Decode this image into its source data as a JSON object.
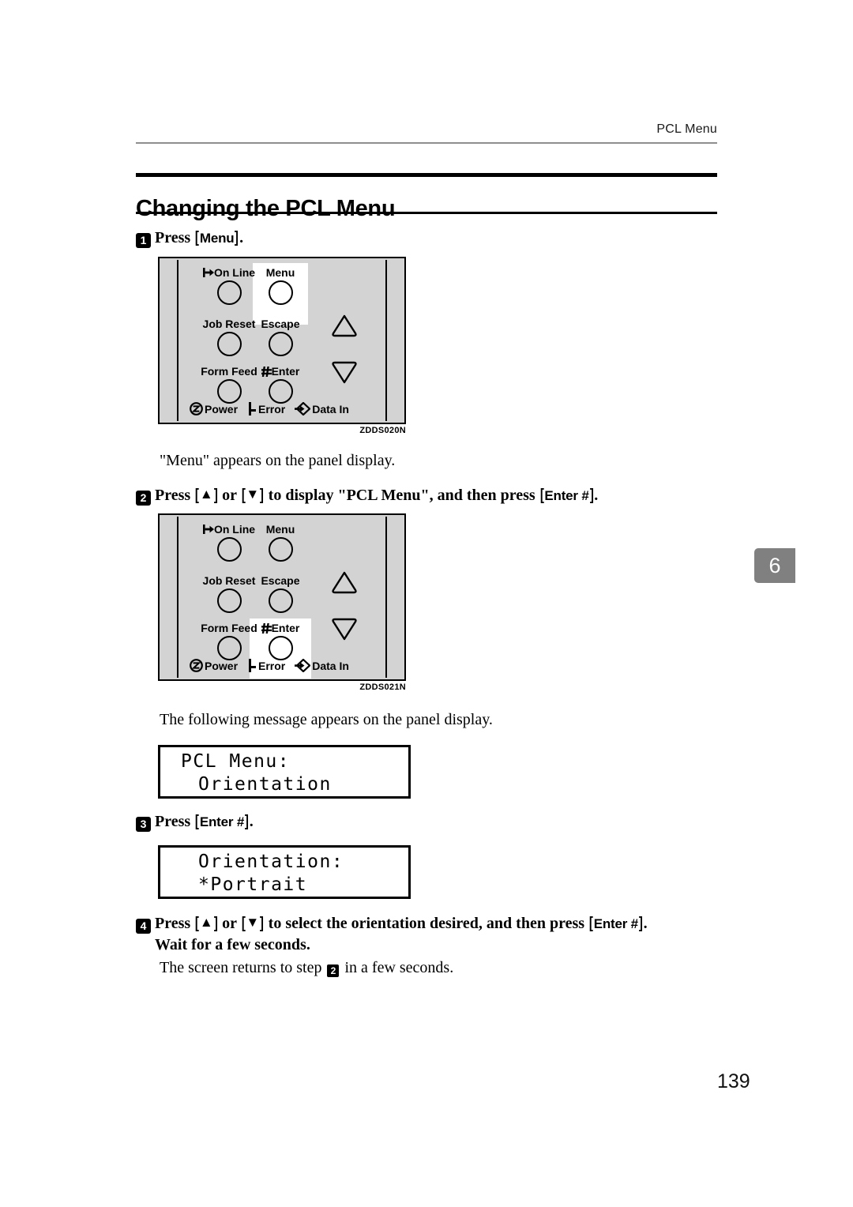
{
  "header": {
    "running_head": "PCL Menu"
  },
  "title": "Changing the PCL Menu",
  "chapter_tab": "6",
  "folio": "139",
  "steps": {
    "step1": {
      "number": "1",
      "text_before": "Press ",
      "key": "Menu",
      "text_after": "."
    },
    "step1_note": "\"Menu\" appears on the panel display.",
    "step2": {
      "number": "2",
      "part1": "Press ",
      "key_up": "▲",
      "part2": " or ",
      "key_down": "▼",
      "part3": " to display \"PCL Menu\", and then press ",
      "key_enter": "Enter #",
      "part4": "."
    },
    "step2_note": "The following message appears on the panel display.",
    "step3": {
      "number": "3",
      "text_before": "Press ",
      "key": "Enter #",
      "text_after": "."
    },
    "step4": {
      "number": "4",
      "part1": "Press ",
      "key_up": "▲",
      "part2": " or ",
      "key_down": "▼",
      "part3": " to select the orientation desired, and then press ",
      "key_enter": "Enter #",
      "part4": ".",
      "line2": "Wait for a few seconds."
    },
    "step4_note_before": "The screen returns to step ",
    "step4_note_ref": "2",
    "step4_note_after": " in a few seconds."
  },
  "panel_figure_1": {
    "figure_code": "ZDDS020N",
    "highlighted_button": "Menu",
    "buttons": [
      {
        "label": "On Line",
        "icon": "online-icon"
      },
      {
        "label": "Menu",
        "icon": ""
      },
      {
        "label": "Job Reset",
        "icon": ""
      },
      {
        "label": "Escape",
        "icon": ""
      },
      {
        "label": "Form Feed",
        "icon": ""
      },
      {
        "label": "Enter",
        "icon": "hash-icon"
      }
    ],
    "arrow_up": "up-triangle-button",
    "arrow_down": "down-triangle-button",
    "indicators": [
      {
        "label": "Power",
        "icon": "power-icon"
      },
      {
        "label": "Error",
        "icon": "error-icon"
      },
      {
        "label": "Data In",
        "icon": "data-in-icon"
      }
    ]
  },
  "panel_figure_2": {
    "figure_code": "ZDDS021N",
    "highlighted_button": "Enter",
    "buttons": [
      {
        "label": "On Line",
        "icon": "online-icon"
      },
      {
        "label": "Menu",
        "icon": ""
      },
      {
        "label": "Job Reset",
        "icon": ""
      },
      {
        "label": "Escape",
        "icon": ""
      },
      {
        "label": "Form Feed",
        "icon": ""
      },
      {
        "label": "Enter",
        "icon": "hash-icon"
      }
    ],
    "arrow_up": "up-triangle-button",
    "arrow_down": "down-triangle-button",
    "indicators": [
      {
        "label": "Power",
        "icon": "power-icon"
      },
      {
        "label": "Error",
        "icon": "error-icon"
      },
      {
        "label": "Data In",
        "icon": "data-in-icon"
      }
    ]
  },
  "lcd_1": {
    "line1": "PCL Menu:",
    "line2": "Orientation"
  },
  "lcd_2": {
    "line1": "Orientation:",
    "line2": "*Portrait"
  }
}
